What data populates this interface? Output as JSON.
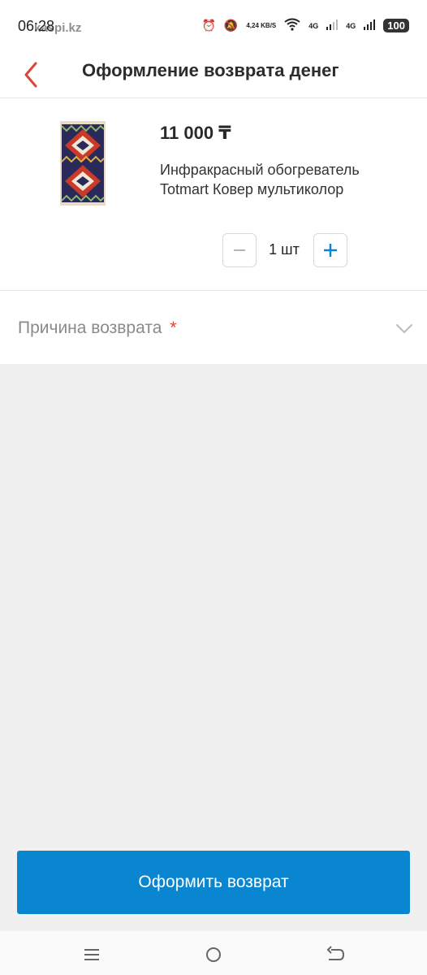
{
  "status_bar": {
    "time": "06:28",
    "watermark": "kaspi.kz",
    "net_speed": "4,24 KB/S",
    "network1": "4G",
    "network2": "4G",
    "battery": "100"
  },
  "header": {
    "title": "Оформление возврата денег"
  },
  "product": {
    "price": "11 000 ₸",
    "name": "Инфракрасный обогреватель Totmart Ковер мультиколор",
    "quantity": "1 шт"
  },
  "reason": {
    "label": "Причина возврата",
    "required_mark": "*"
  },
  "submit": {
    "label": "Оформить возврат"
  },
  "colors": {
    "accent": "#0a86d0",
    "back_arrow": "#d9473a",
    "required": "#e0432b"
  }
}
